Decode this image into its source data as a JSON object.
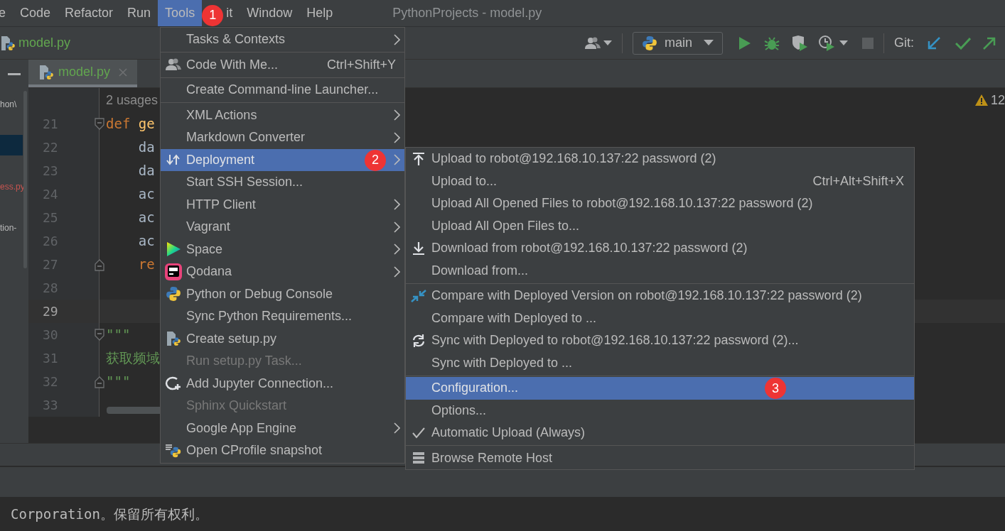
{
  "menubar": {
    "items": [
      {
        "label": "e",
        "selected": false
      },
      {
        "label": "Code",
        "selected": false
      },
      {
        "label": "Refactor",
        "selected": false
      },
      {
        "label": "Run",
        "selected": false
      },
      {
        "label": "Tools",
        "selected": true,
        "badge": "1"
      },
      {
        "label": "it",
        "selected": false
      },
      {
        "label": "Window",
        "selected": false
      },
      {
        "label": "Help",
        "selected": false
      }
    ],
    "title": "PythonProjects - model.py"
  },
  "toolbar": {
    "breadcrumb": "model.py",
    "run_config": "main",
    "git_label": "Git:"
  },
  "tabs": [
    {
      "label": "model.py",
      "selected": true
    }
  ],
  "project_panel": {
    "items": [
      {
        "label": "hon\\",
        "selected": false,
        "color": "#bbbbbb"
      },
      {
        "selected": true
      },
      {
        "label": "ess.py",
        "selected": false,
        "color": "#c75450"
      },
      {
        "label": "tion-",
        "selected": false,
        "color": "#bbbbbb"
      }
    ]
  },
  "editor": {
    "usages": "2 usages",
    "warning_count": "12",
    "lines": [
      {
        "number": "21",
        "kind": "fold-start",
        "current": false,
        "tokens": [
          {
            "kind": "keyword",
            "text": "def "
          },
          {
            "kind": "function",
            "text": "ge"
          }
        ]
      },
      {
        "number": "22",
        "kind": "plain",
        "current": false,
        "tokens": [
          {
            "kind": "plain",
            "text": "    da"
          }
        ]
      },
      {
        "number": "23",
        "kind": "plain",
        "current": false,
        "tokens": [
          {
            "kind": "plain",
            "text": "    da"
          }
        ]
      },
      {
        "number": "24",
        "kind": "plain",
        "current": false,
        "tokens": [
          {
            "kind": "plain",
            "text": "    ac"
          }
        ]
      },
      {
        "number": "25",
        "kind": "plain",
        "current": false,
        "tokens": [
          {
            "kind": "plain",
            "text": "    ac"
          }
        ]
      },
      {
        "number": "26",
        "kind": "plain",
        "current": false,
        "tokens": [
          {
            "kind": "plain",
            "text": "    ac"
          }
        ]
      },
      {
        "number": "27",
        "kind": "fold-end",
        "current": false,
        "tokens": [
          {
            "kind": "keyword",
            "text": "    re"
          }
        ]
      },
      {
        "number": "28",
        "kind": "plain",
        "current": false
      },
      {
        "number": "29",
        "kind": "plain",
        "current": true
      },
      {
        "number": "30",
        "kind": "fold-start",
        "current": false,
        "tokens": [
          {
            "kind": "docstring",
            "text": "\"\"\""
          }
        ]
      },
      {
        "number": "31",
        "kind": "plain",
        "current": false,
        "tokens": [
          {
            "kind": "docstring",
            "text": "获取频域"
          }
        ]
      },
      {
        "number": "32",
        "kind": "fold-end",
        "current": false,
        "tokens": [
          {
            "kind": "docstring",
            "text": "\"\"\""
          }
        ]
      },
      {
        "number": "33",
        "kind": "plain",
        "current": false
      }
    ]
  },
  "tools_menu": {
    "groups": [
      {
        "items": [
          {
            "label": "Tasks & Contexts",
            "kind": "plain",
            "submenu": true,
            "selected": false,
            "disabled": false
          }
        ]
      },
      {
        "items": [
          {
            "label": "Code With Me...",
            "kind": "person",
            "shortcut": "Ctrl+Shift+Y",
            "submenu": false,
            "selected": false,
            "disabled": false
          }
        ]
      },
      {
        "items": [
          {
            "label": "Create Command-line Launcher...",
            "kind": "plain",
            "submenu": false,
            "selected": false,
            "disabled": false
          }
        ]
      },
      {
        "items": [
          {
            "label": "XML Actions",
            "kind": "plain",
            "submenu": true,
            "selected": false,
            "disabled": false
          },
          {
            "label": "Markdown Converter",
            "kind": "plain",
            "submenu": true,
            "selected": false,
            "disabled": false
          },
          {
            "label": "Deployment",
            "kind": "deploy",
            "submenu": true,
            "selected": true,
            "disabled": false,
            "badge": "2"
          },
          {
            "label": "Start SSH Session...",
            "kind": "plain",
            "submenu": false,
            "selected": false,
            "disabled": false
          },
          {
            "label": "HTTP Client",
            "kind": "plain",
            "submenu": true,
            "selected": false,
            "disabled": false
          },
          {
            "label": "Vagrant",
            "kind": "plain",
            "submenu": true,
            "selected": false,
            "disabled": false
          },
          {
            "label": "Space",
            "kind": "space",
            "submenu": true,
            "selected": false,
            "disabled": false
          },
          {
            "label": "Qodana",
            "kind": "qodana",
            "submenu": true,
            "selected": false,
            "disabled": false
          },
          {
            "label": "Python or Debug Console",
            "kind": "python",
            "submenu": false,
            "selected": false,
            "disabled": false
          },
          {
            "label": "Sync Python Requirements...",
            "kind": "plain",
            "submenu": false,
            "selected": false,
            "disabled": false
          },
          {
            "label": "Create setup.py",
            "kind": "python-file",
            "submenu": false,
            "selected": false,
            "disabled": false
          },
          {
            "label": "Run setup.py Task...",
            "kind": "plain",
            "submenu": false,
            "selected": false,
            "disabled": true
          },
          {
            "label": "Add Jupyter Connection...",
            "kind": "jupyter",
            "submenu": false,
            "selected": false,
            "disabled": false
          },
          {
            "label": "Sphinx Quickstart",
            "kind": "plain",
            "submenu": false,
            "selected": false,
            "disabled": true
          },
          {
            "label": "Google App Engine",
            "kind": "plain",
            "submenu": true,
            "selected": false,
            "disabled": false
          },
          {
            "label": "Open CProfile snapshot",
            "kind": "cprofile",
            "submenu": false,
            "selected": false,
            "disabled": false
          }
        ]
      }
    ]
  },
  "deployment_menu": {
    "groups": [
      {
        "items": [
          {
            "label": "Upload to robot@192.168.10.137:22 password (2)",
            "kind": "upload",
            "selected": false,
            "checked": false
          },
          {
            "label": "Upload to...",
            "kind": "plain",
            "shortcut": "Ctrl+Alt+Shift+X",
            "selected": false,
            "checked": false
          },
          {
            "label": "Upload All Opened Files to robot@192.168.10.137:22 password (2)",
            "kind": "plain",
            "selected": false,
            "checked": false
          },
          {
            "label": "Upload All Open Files to...",
            "kind": "plain",
            "selected": false,
            "checked": false
          },
          {
            "label": "Download from robot@192.168.10.137:22 password (2)",
            "kind": "download",
            "selected": false,
            "checked": false
          },
          {
            "label": "Download from...",
            "kind": "plain",
            "selected": false,
            "checked": false
          }
        ]
      },
      {
        "items": [
          {
            "label": "Compare with Deployed Version on robot@192.168.10.137:22 password (2)",
            "kind": "compare",
            "selected": false,
            "checked": false
          },
          {
            "label": "Compare with Deployed to ...",
            "kind": "plain",
            "selected": false,
            "checked": false
          },
          {
            "label": "Sync with Deployed to robot@192.168.10.137:22 password (2)...",
            "kind": "sync",
            "selected": false,
            "checked": false
          },
          {
            "label": "Sync with Deployed to ...",
            "kind": "plain",
            "selected": false,
            "checked": false
          }
        ]
      },
      {
        "items": [
          {
            "label": "Configuration...",
            "kind": "plain",
            "selected": true,
            "checked": false,
            "badge": "3"
          },
          {
            "label": "Options...",
            "kind": "plain",
            "selected": false,
            "checked": false
          },
          {
            "label": "Automatic Upload (Always)",
            "kind": "plain",
            "checked": true,
            "selected": false
          }
        ]
      },
      {
        "items": [
          {
            "label": "Browse Remote Host",
            "kind": "server",
            "selected": false,
            "checked": false
          }
        ]
      }
    ]
  },
  "terminal": {
    "text": "Corporation。保留所有权利。"
  }
}
